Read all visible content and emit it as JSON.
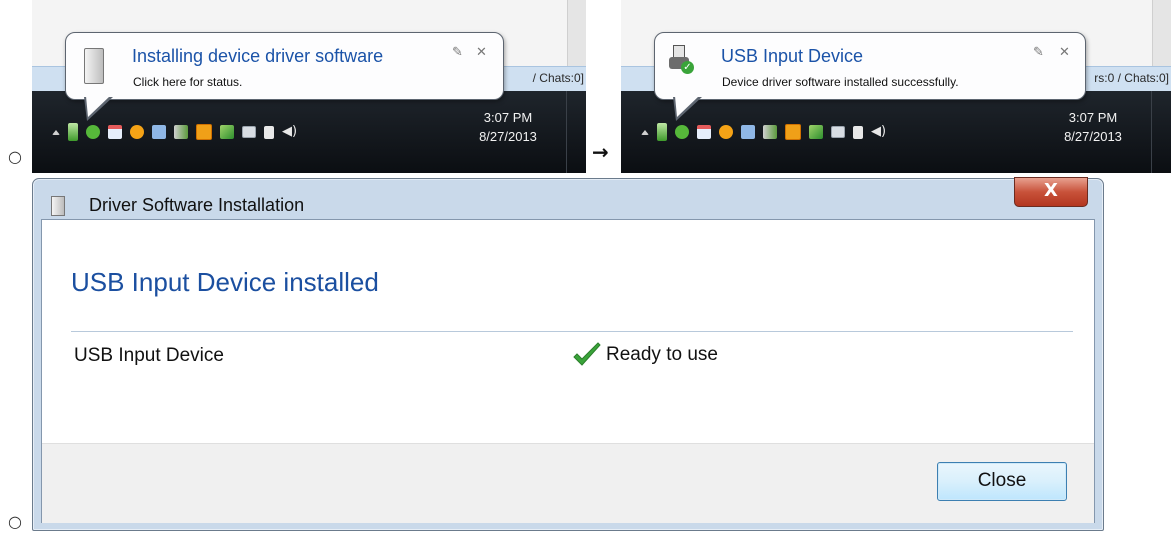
{
  "steps": {
    "bullet": "○",
    "arrow": "→"
  },
  "shot1": {
    "balloon_title": "Installing device driver software",
    "balloon_text": "Click here for status.",
    "background_text": "/ Chats:0]",
    "clock_time": "3:07 PM",
    "clock_date": "8/27/2013"
  },
  "shot2": {
    "balloon_title": "USB Input Device",
    "balloon_text": "Device driver software installed successfully.",
    "background_text": "rs:0 / Chats:0]",
    "clock_time": "3:07 PM",
    "clock_date": "8/27/2013"
  },
  "balloon_buttons": {
    "pin": "✎",
    "close": "✕"
  },
  "dialog": {
    "title": "Driver Software Installation",
    "close_glyph": "X",
    "heading": "USB Input Device installed",
    "device_name": "USB Input Device",
    "device_status": "Ready to use",
    "close_button": "Close"
  },
  "colors": {
    "title_blue": "#1b4fa0",
    "check_green": "#3aa43a",
    "close_red": "#c8523a",
    "taskbar": "#0b0e12"
  },
  "icons": [
    "usb-device-icon",
    "check-icon",
    "close-icon",
    "pin-icon",
    "volume-icon",
    "network-icon"
  ]
}
